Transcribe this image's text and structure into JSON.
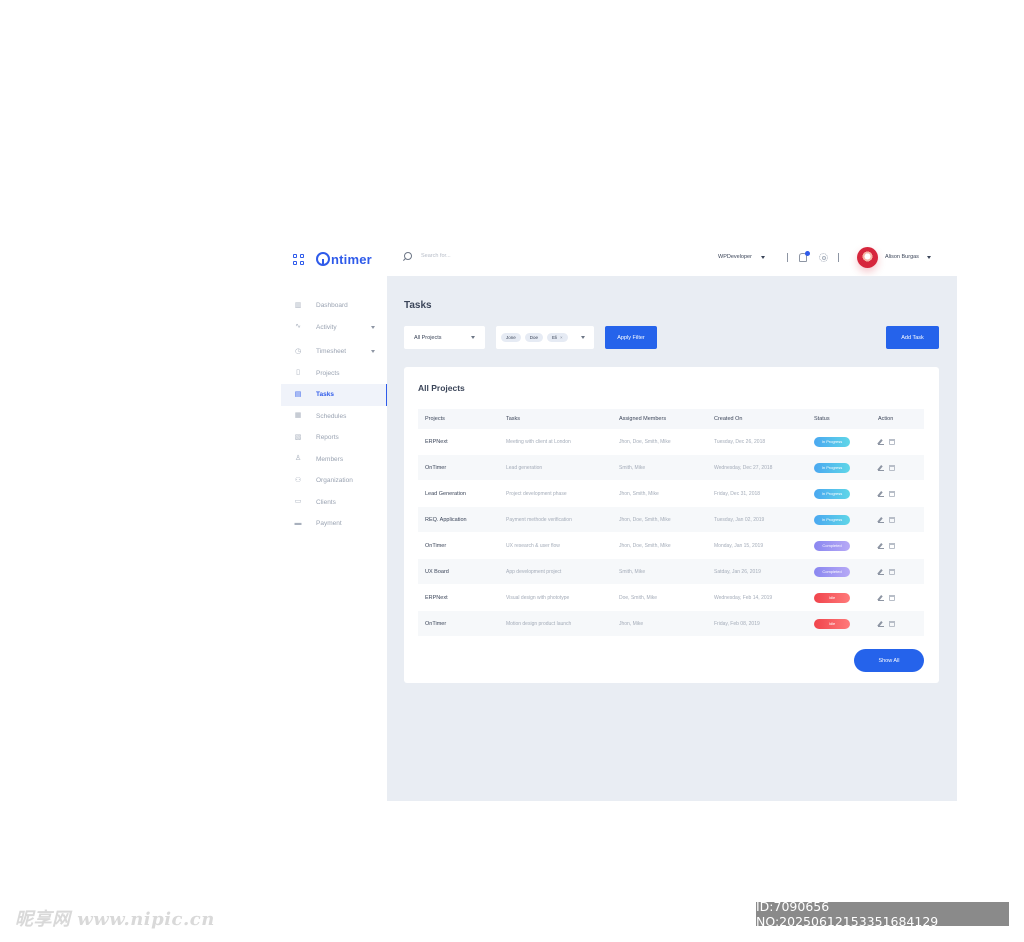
{
  "brand": {
    "name": "ntimer"
  },
  "sidebar": {
    "items": [
      {
        "label": "Dashboard",
        "icon": "bar-chart-icon",
        "glyph": "▥"
      },
      {
        "label": "Activity",
        "icon": "pulse-icon",
        "glyph": "∿",
        "caret": true
      },
      {
        "label": "Timesheet",
        "icon": "clock-icon",
        "glyph": "◷",
        "caret": true
      },
      {
        "label": "Projects",
        "icon": "file-icon",
        "glyph": "▯"
      },
      {
        "label": "Tasks",
        "icon": "tasks-icon",
        "glyph": "▤",
        "active": true
      },
      {
        "label": "Schedules",
        "icon": "calendar-icon",
        "glyph": "▦"
      },
      {
        "label": "Reports",
        "icon": "report-icon",
        "glyph": "▧"
      },
      {
        "label": "Members",
        "icon": "members-icon",
        "glyph": "♙"
      },
      {
        "label": "Organization",
        "icon": "organization-icon",
        "glyph": "⚇"
      },
      {
        "label": "Clients",
        "icon": "clients-icon",
        "glyph": "▭"
      },
      {
        "label": "Payment",
        "icon": "payment-icon",
        "glyph": "▬"
      }
    ]
  },
  "topbar": {
    "search_placeholder": "Search for...",
    "workspace": "WPDeveloper",
    "user_name": "Alison Burgas"
  },
  "main": {
    "title": "Tasks",
    "filter_projects": "All Projects",
    "chips": [
      "Jone",
      "Doe",
      "Eli"
    ],
    "apply_label": "Apply Filter",
    "add_label": "Add Task",
    "card_title": "All Projects",
    "columns": [
      "Projects",
      "Tasks",
      "Assigned Members",
      "Created On",
      "Status",
      "Action"
    ],
    "rows": [
      {
        "project": "ERPNext",
        "task": "Meeting with client at London",
        "members": "Jhon, Doe, Smith, Mike",
        "created": "Tuesday, Dec 26, 2018",
        "status": "In Progress",
        "kind": "prog"
      },
      {
        "project": "OnTimer",
        "task": "Lead generation",
        "members": "Smith, Mike",
        "created": "Wednesday, Dec 27, 2018",
        "status": "In Progress",
        "kind": "prog"
      },
      {
        "project": "Lead Generation",
        "task": "Project development phase",
        "members": "Jhon, Smith, Mike",
        "created": "Friday, Dec 31, 2018",
        "status": "In Progress",
        "kind": "prog"
      },
      {
        "project": "REQ. Application",
        "task": "Payment methode verification",
        "members": "Jhon, Doe, Smith, Mike",
        "created": "Tuesday, Jan 02, 2019",
        "status": "In Progress",
        "kind": "prog"
      },
      {
        "project": "OnTimer",
        "task": "UX research & user flow",
        "members": "Jhon, Doe, Smith, Mike",
        "created": "Monday, Jan 15, 2019",
        "status": "Completed",
        "kind": "comp"
      },
      {
        "project": "UX Board",
        "task": "App development project",
        "members": "Smith, Mike",
        "created": "Satday, Jan 26, 2019",
        "status": "Completed",
        "kind": "comp"
      },
      {
        "project": "ERPNext",
        "task": "Visual design with phototype",
        "members": "Doe, Smith, Mike",
        "created": "Wednesday, Feb 14, 2019",
        "status": "Idle",
        "kind": "idle"
      },
      {
        "project": "OnTimer",
        "task": "Motion design product launch",
        "members": "Jhon, Mike",
        "created": "Friday, Feb 08, 2019",
        "status": "Idle",
        "kind": "idle"
      }
    ],
    "show_all_label": "Show All"
  },
  "watermark": {
    "left": "昵享网 www.nipic.cn",
    "right": "ID:7090656 NO:20250612153351684129"
  },
  "colors": {
    "accent": "#2563eb",
    "background": "#e9edf3",
    "in_progress": "#4aa8f0",
    "completed": "#8a87f0",
    "idle": "#f0444c"
  }
}
